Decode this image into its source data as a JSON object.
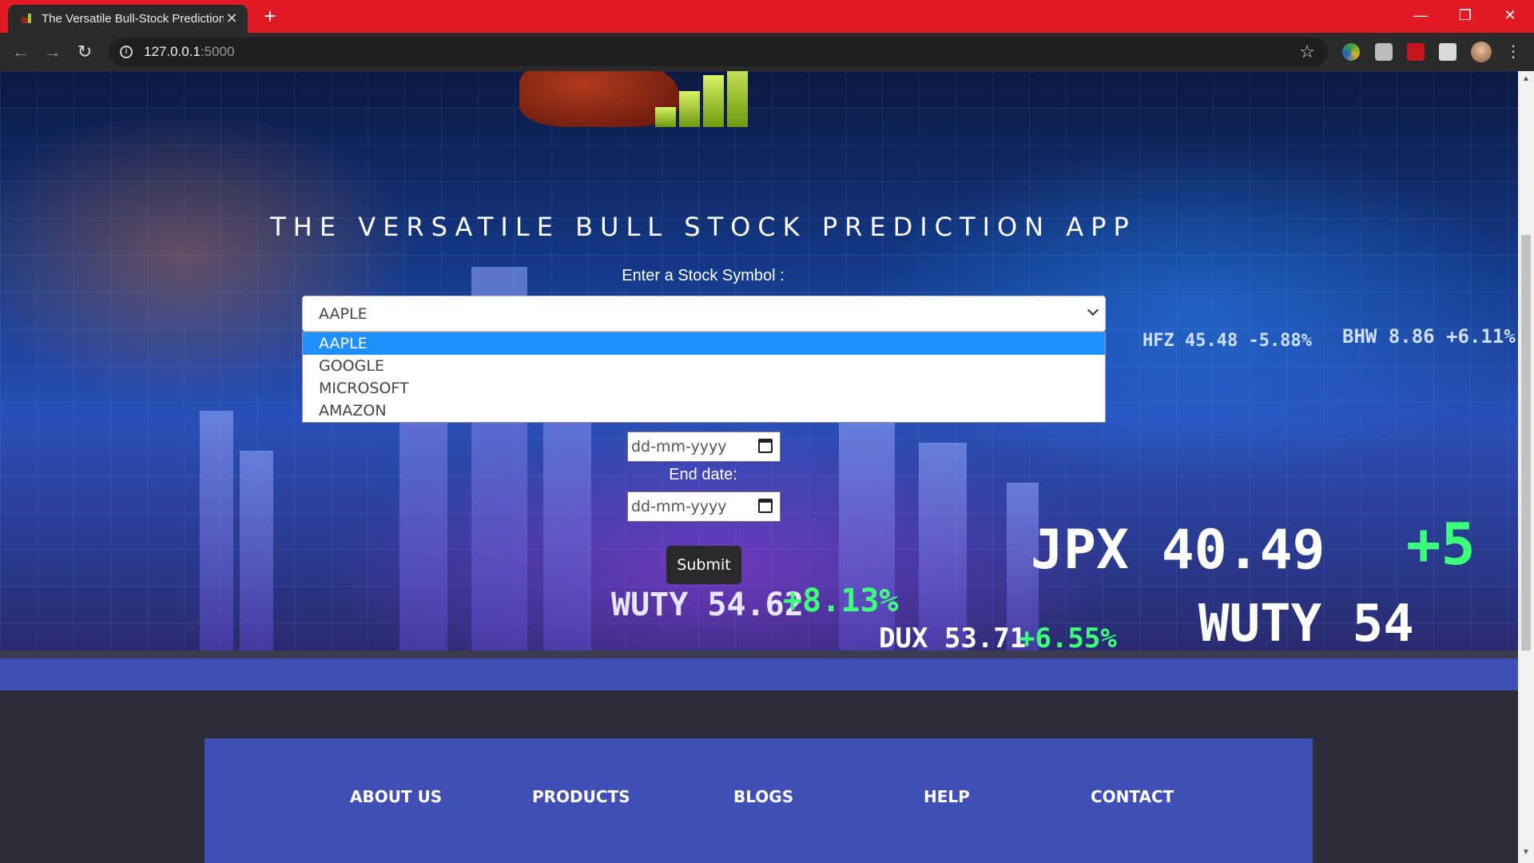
{
  "browser": {
    "tab_title": "The Versatile Bull-Stock Prediction App",
    "new_tab_symbol": "+",
    "url_host": "127.0.0.1",
    "url_port": ":5000"
  },
  "app": {
    "title": "THE VERSATILE BULL STOCK PREDICTION APP",
    "symbol_label": "Enter a Stock Symbol :",
    "selected_symbol": "AAPLE",
    "symbol_options": [
      "AAPLE",
      "GOOGLE",
      "MICROSOFT",
      "AMAZON"
    ],
    "start_date_placeholder": "dd-mm-yyyy",
    "end_date_label": "End date:",
    "end_date_placeholder": "dd-mm-yyyy",
    "submit_label": "Submit"
  },
  "footer": {
    "links": [
      "ABOUT US",
      "PRODUCTS",
      "BLOGS",
      "HELP",
      "CONTACT"
    ]
  },
  "background_tickers": [
    "HFZ 45.48 -5.88%",
    "BHW 8.86 +6.11%",
    "JPX 40.49",
    "+5",
    "WUTY 54.62",
    "+8.13%",
    "WUTY 54",
    "DUX 53.71",
    "+6.55%"
  ],
  "colors": {
    "tab_strip": "#e21a26",
    "dropdown_highlight": "#1e90ff",
    "footer_blue": "#3f4fb5",
    "submit_button": "#2a2a2a"
  }
}
